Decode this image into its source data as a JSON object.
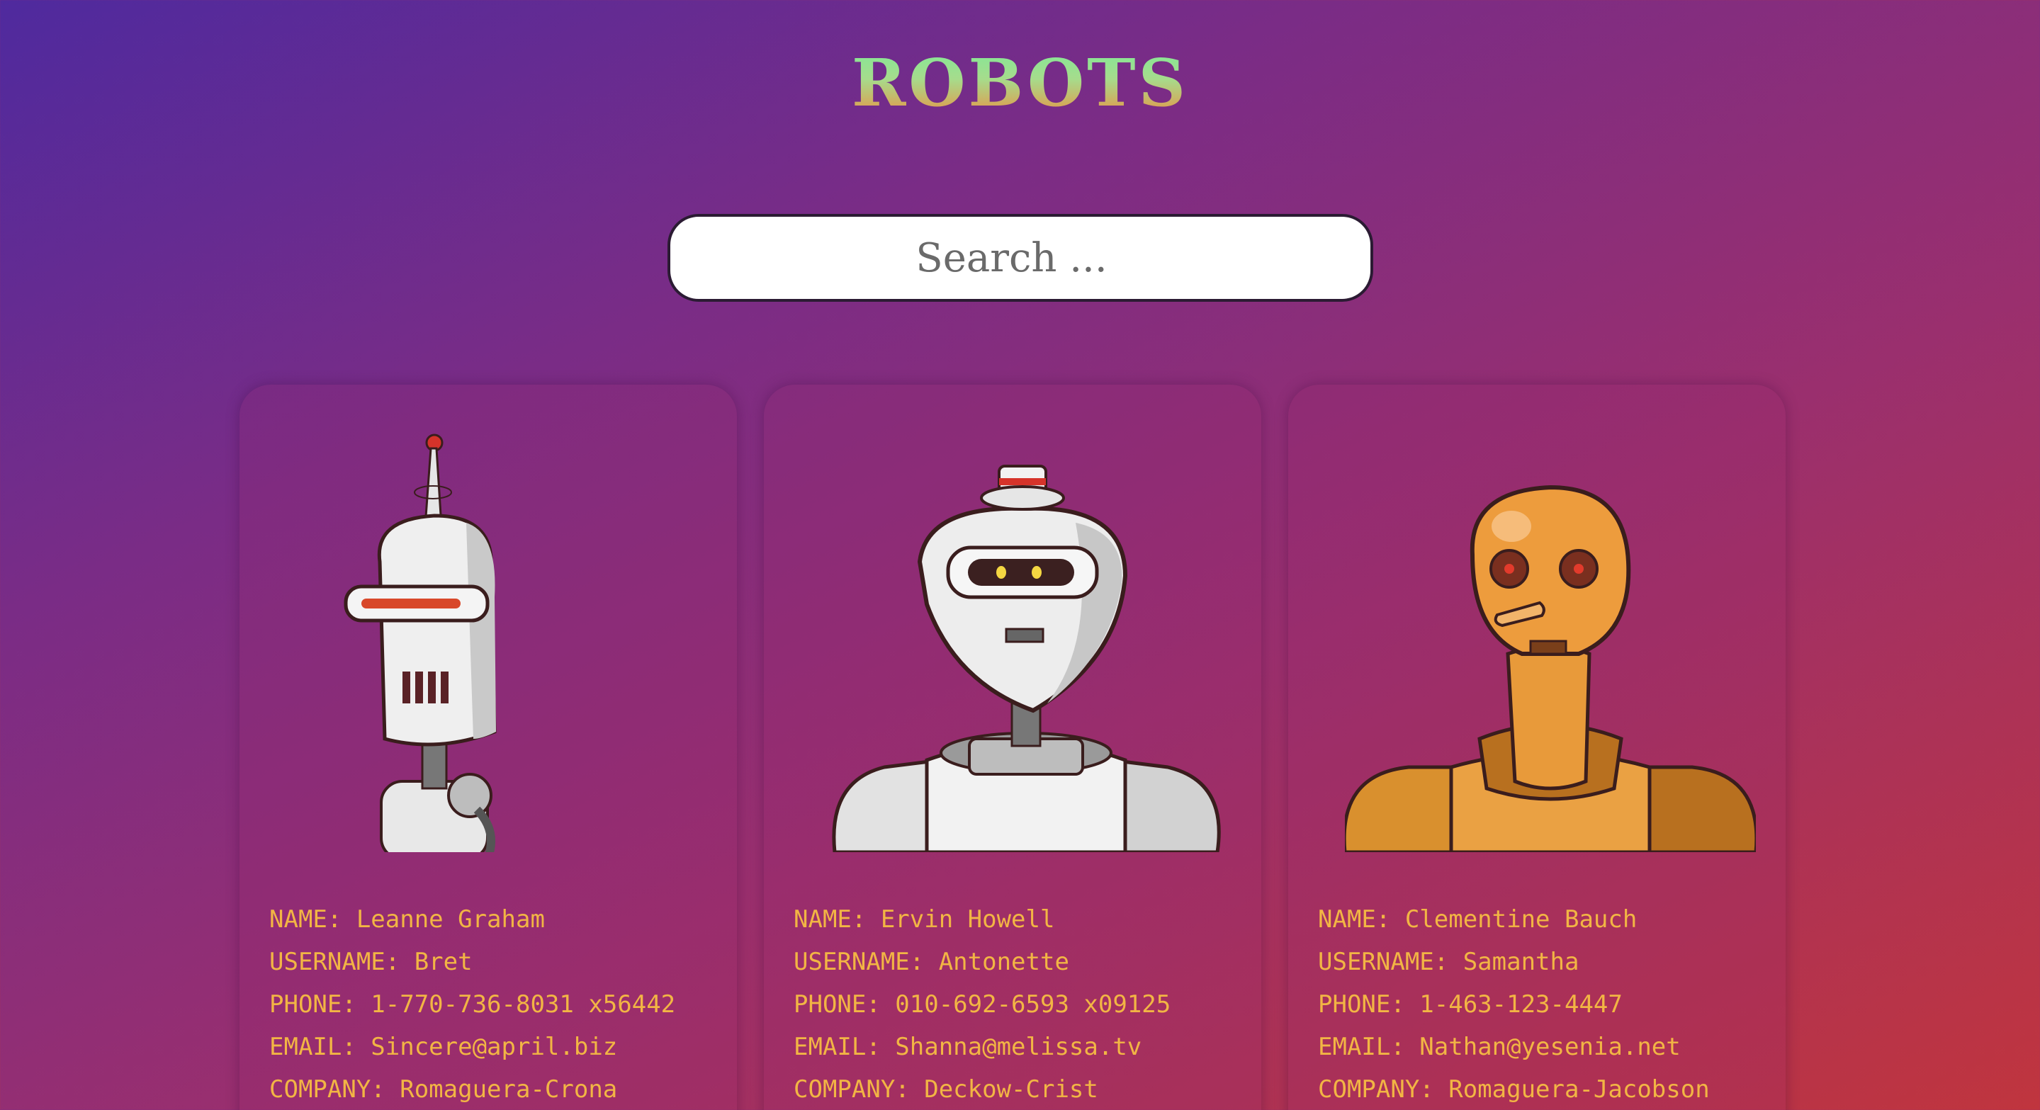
{
  "header": {
    "title": "ROBOTS"
  },
  "search": {
    "placeholder": "Search ..."
  },
  "robots": [
    {
      "name_label": "NAME: Leanne Graham",
      "username_label": "USERNAME: Bret",
      "phone_label": "PHONE: 1-770-736-8031 x56442",
      "email_label": "EMAIL: Sincere@april.biz",
      "company_label": "COMPANY: Romaguera-Crona"
    },
    {
      "name_label": "NAME: Ervin Howell",
      "username_label": "USERNAME: Antonette",
      "phone_label": "PHONE: 010-692-6593 x09125",
      "email_label": "EMAIL: Shanna@melissa.tv",
      "company_label": "COMPANY: Deckow-Crist"
    },
    {
      "name_label": "NAME: Clementine Bauch",
      "username_label": "USERNAME: Samantha",
      "phone_label": "PHONE: 1-463-123-4447",
      "email_label": "EMAIL: Nathan@yesenia.net",
      "company_label": "COMPANY: Romaguera-Jacobson"
    }
  ],
  "colors": {
    "title_top": "#7ee99a",
    "title_bottom": "#f08a3c",
    "info_text": "#f2b544",
    "background_start": "#4f2a9e",
    "background_end": "#c0353e"
  }
}
